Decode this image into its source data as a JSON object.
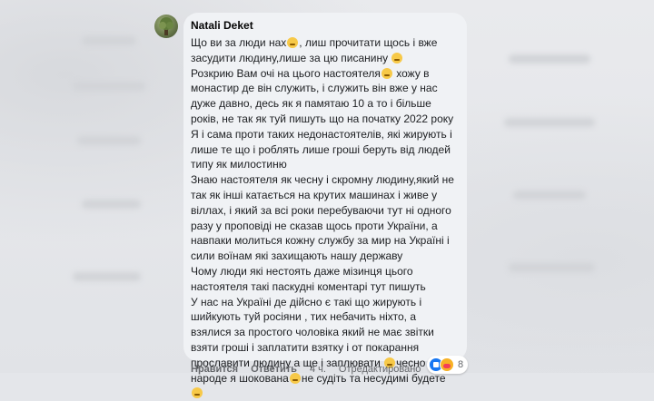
{
  "comment": {
    "author": "Natali Deket",
    "paragraphs": [
      "Що ви за люди нах",
      ", лиш прочитати щось і вже засудити людину,лише за цю писанину ",
      "Розкрию Вам очі на цього настоятеля",
      " хожу в монастир де він служить, і служить він вже у нас дуже давно, десь як я памятаю 10 а то і більше років, не так як туй пишуть що на початку 2022 року",
      "Я і сама проти таких недонастоятелів, які жирують і лише те що і роблять лише гроші беруть від людей типу як милостиню",
      "Знаю настоятеля як чесну і скромну людину,який не так як інші катається на крутих машинах і живе у віллах, і який за всі роки перебуваючи тут ні одного разу у проповіді не сказав щось проти України, а навпаки молиться кожну службу за мир на Україні і сили воїнам які захищають нашу державу",
      "Чому люди які нестоять даже мізинця цього настоятеля такі паскудні коментарі тут пишуть",
      "У нас на Україні де дійсно є такі що жирують і шийкують туй росіяни , тих небачить ніхто, а взялися за простого чоловіка який не має звітки взяти гроші і заплатити взятку і от покарання прославити людину а ще і заплювати ",
      "чесно народе я шокована",
      "не судіть та несудимі будете"
    ]
  },
  "actions": {
    "like": "Нравится",
    "reply": "Ответить",
    "time": "4 ч.",
    "edited": "Отредактировано"
  },
  "reactions": {
    "count": "8",
    "icons": [
      "like-icon",
      "care-icon"
    ]
  },
  "emoji": {
    "name": "pensive-face-emoji",
    "color": "#f7c948"
  }
}
